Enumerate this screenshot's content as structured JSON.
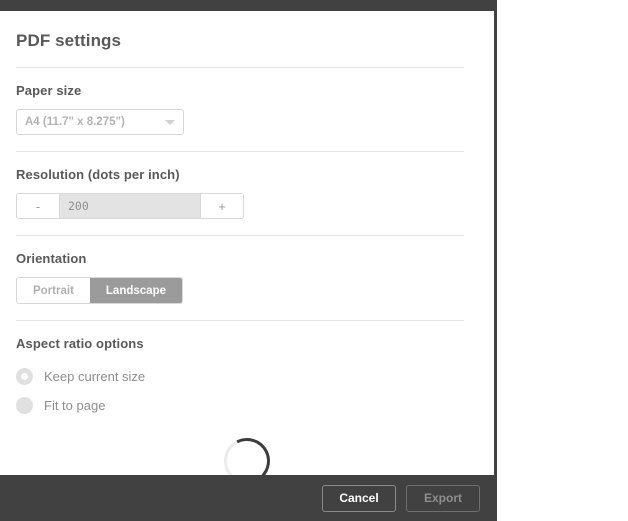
{
  "dialog": {
    "title": "PDF settings",
    "sections": {
      "paper_size": {
        "label": "Paper size",
        "selected": "A4 (11.7\" x 8.275\")",
        "chevron_icon": "chevron-down-icon"
      },
      "resolution": {
        "label": "Resolution (dots per inch)",
        "decrement_label": "-",
        "increment_label": "+",
        "value": "200"
      },
      "orientation": {
        "label": "Orientation",
        "options": [
          {
            "label": "Portrait",
            "selected": false
          },
          {
            "label": "Landscape",
            "selected": true
          }
        ]
      },
      "aspect_ratio": {
        "label": "Aspect ratio options",
        "options": [
          {
            "label": "Keep current size",
            "selected": true
          },
          {
            "label": "Fit to page",
            "selected": false
          }
        ]
      }
    },
    "loading": {
      "icon": "loading-spinner-icon"
    },
    "footer": {
      "cancel_label": "Cancel",
      "export_label": "Export"
    }
  },
  "colors": {
    "chrome_dark": "#414141",
    "heading_text": "#595959",
    "muted_text": "#8d8d8d",
    "control_border": "#d8d8d8",
    "toggle_active_bg": "#9b9b9b",
    "disabled_input_bg": "#e3e3e3",
    "spinner_track": "#ececec",
    "spinner_arc": "#3d3d3d"
  }
}
